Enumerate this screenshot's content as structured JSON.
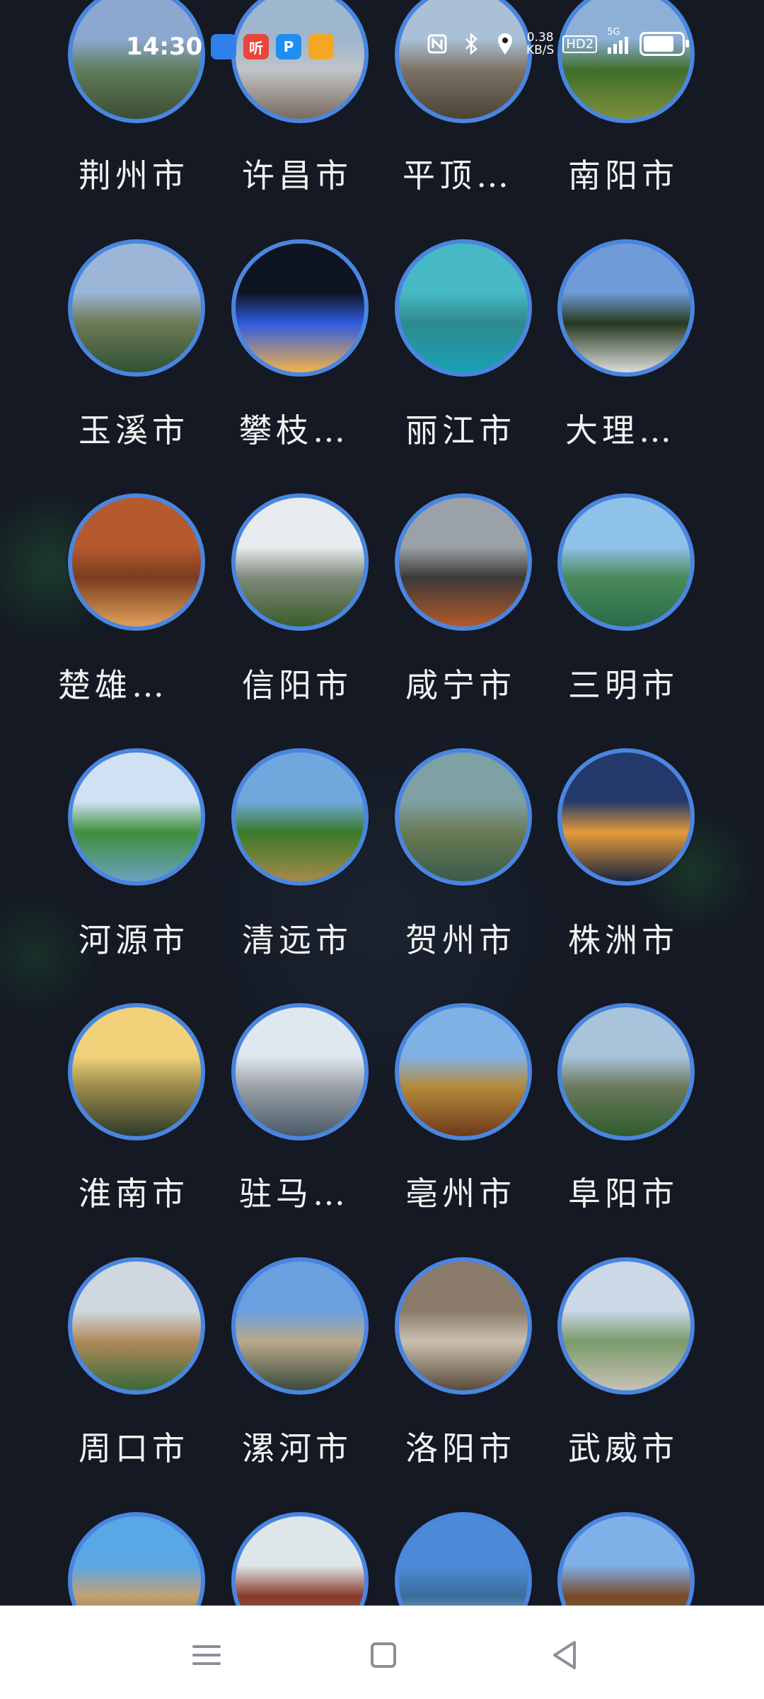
{
  "status_bar": {
    "time": "14:30",
    "net_speed_value": "0.38",
    "net_speed_unit": "KB/S",
    "hd_label": "HD2",
    "signal_label": "5G",
    "battery_level": 0.8,
    "app_icons": [
      {
        "name": "qq-browser-icon",
        "label": "",
        "color": "#2f80ed"
      },
      {
        "name": "ting-app-icon",
        "label": "听",
        "color": "#e8453c"
      },
      {
        "name": "p-app-icon",
        "label": "P",
        "color": "#1f8ef1"
      },
      {
        "name": "colorful-app-icon",
        "label": "",
        "color": "#f5a623"
      }
    ]
  },
  "cities": [
    {
      "name": "荆州市"
    },
    {
      "name": "许昌市"
    },
    {
      "name": "平顶…"
    },
    {
      "name": "南阳市"
    },
    {
      "name": "玉溪市"
    },
    {
      "name": "攀枝…"
    },
    {
      "name": "丽江市"
    },
    {
      "name": "大理…"
    },
    {
      "name": "楚雄…"
    },
    {
      "name": "信阳市"
    },
    {
      "name": "咸宁市"
    },
    {
      "name": "三明市"
    },
    {
      "name": "河源市"
    },
    {
      "name": "清远市"
    },
    {
      "name": "贺州市"
    },
    {
      "name": "株洲市"
    },
    {
      "name": "淮南市"
    },
    {
      "name": "驻马…"
    },
    {
      "name": "亳州市"
    },
    {
      "name": "阜阳市"
    },
    {
      "name": "周口市"
    },
    {
      "name": "漯河市"
    },
    {
      "name": "洛阳市"
    },
    {
      "name": "武威市"
    },
    {
      "name": ""
    },
    {
      "name": ""
    },
    {
      "name": ""
    },
    {
      "name": ""
    }
  ],
  "colors": {
    "background": "#141923",
    "circle_border": "#4a86e0",
    "label": "#f2f2f2",
    "nav_bar": "#ffffff",
    "nav_icon": "#8a8f99"
  },
  "nav_bar": {
    "icons": [
      "menu-icon",
      "home-square-icon",
      "back-triangle-icon"
    ]
  }
}
